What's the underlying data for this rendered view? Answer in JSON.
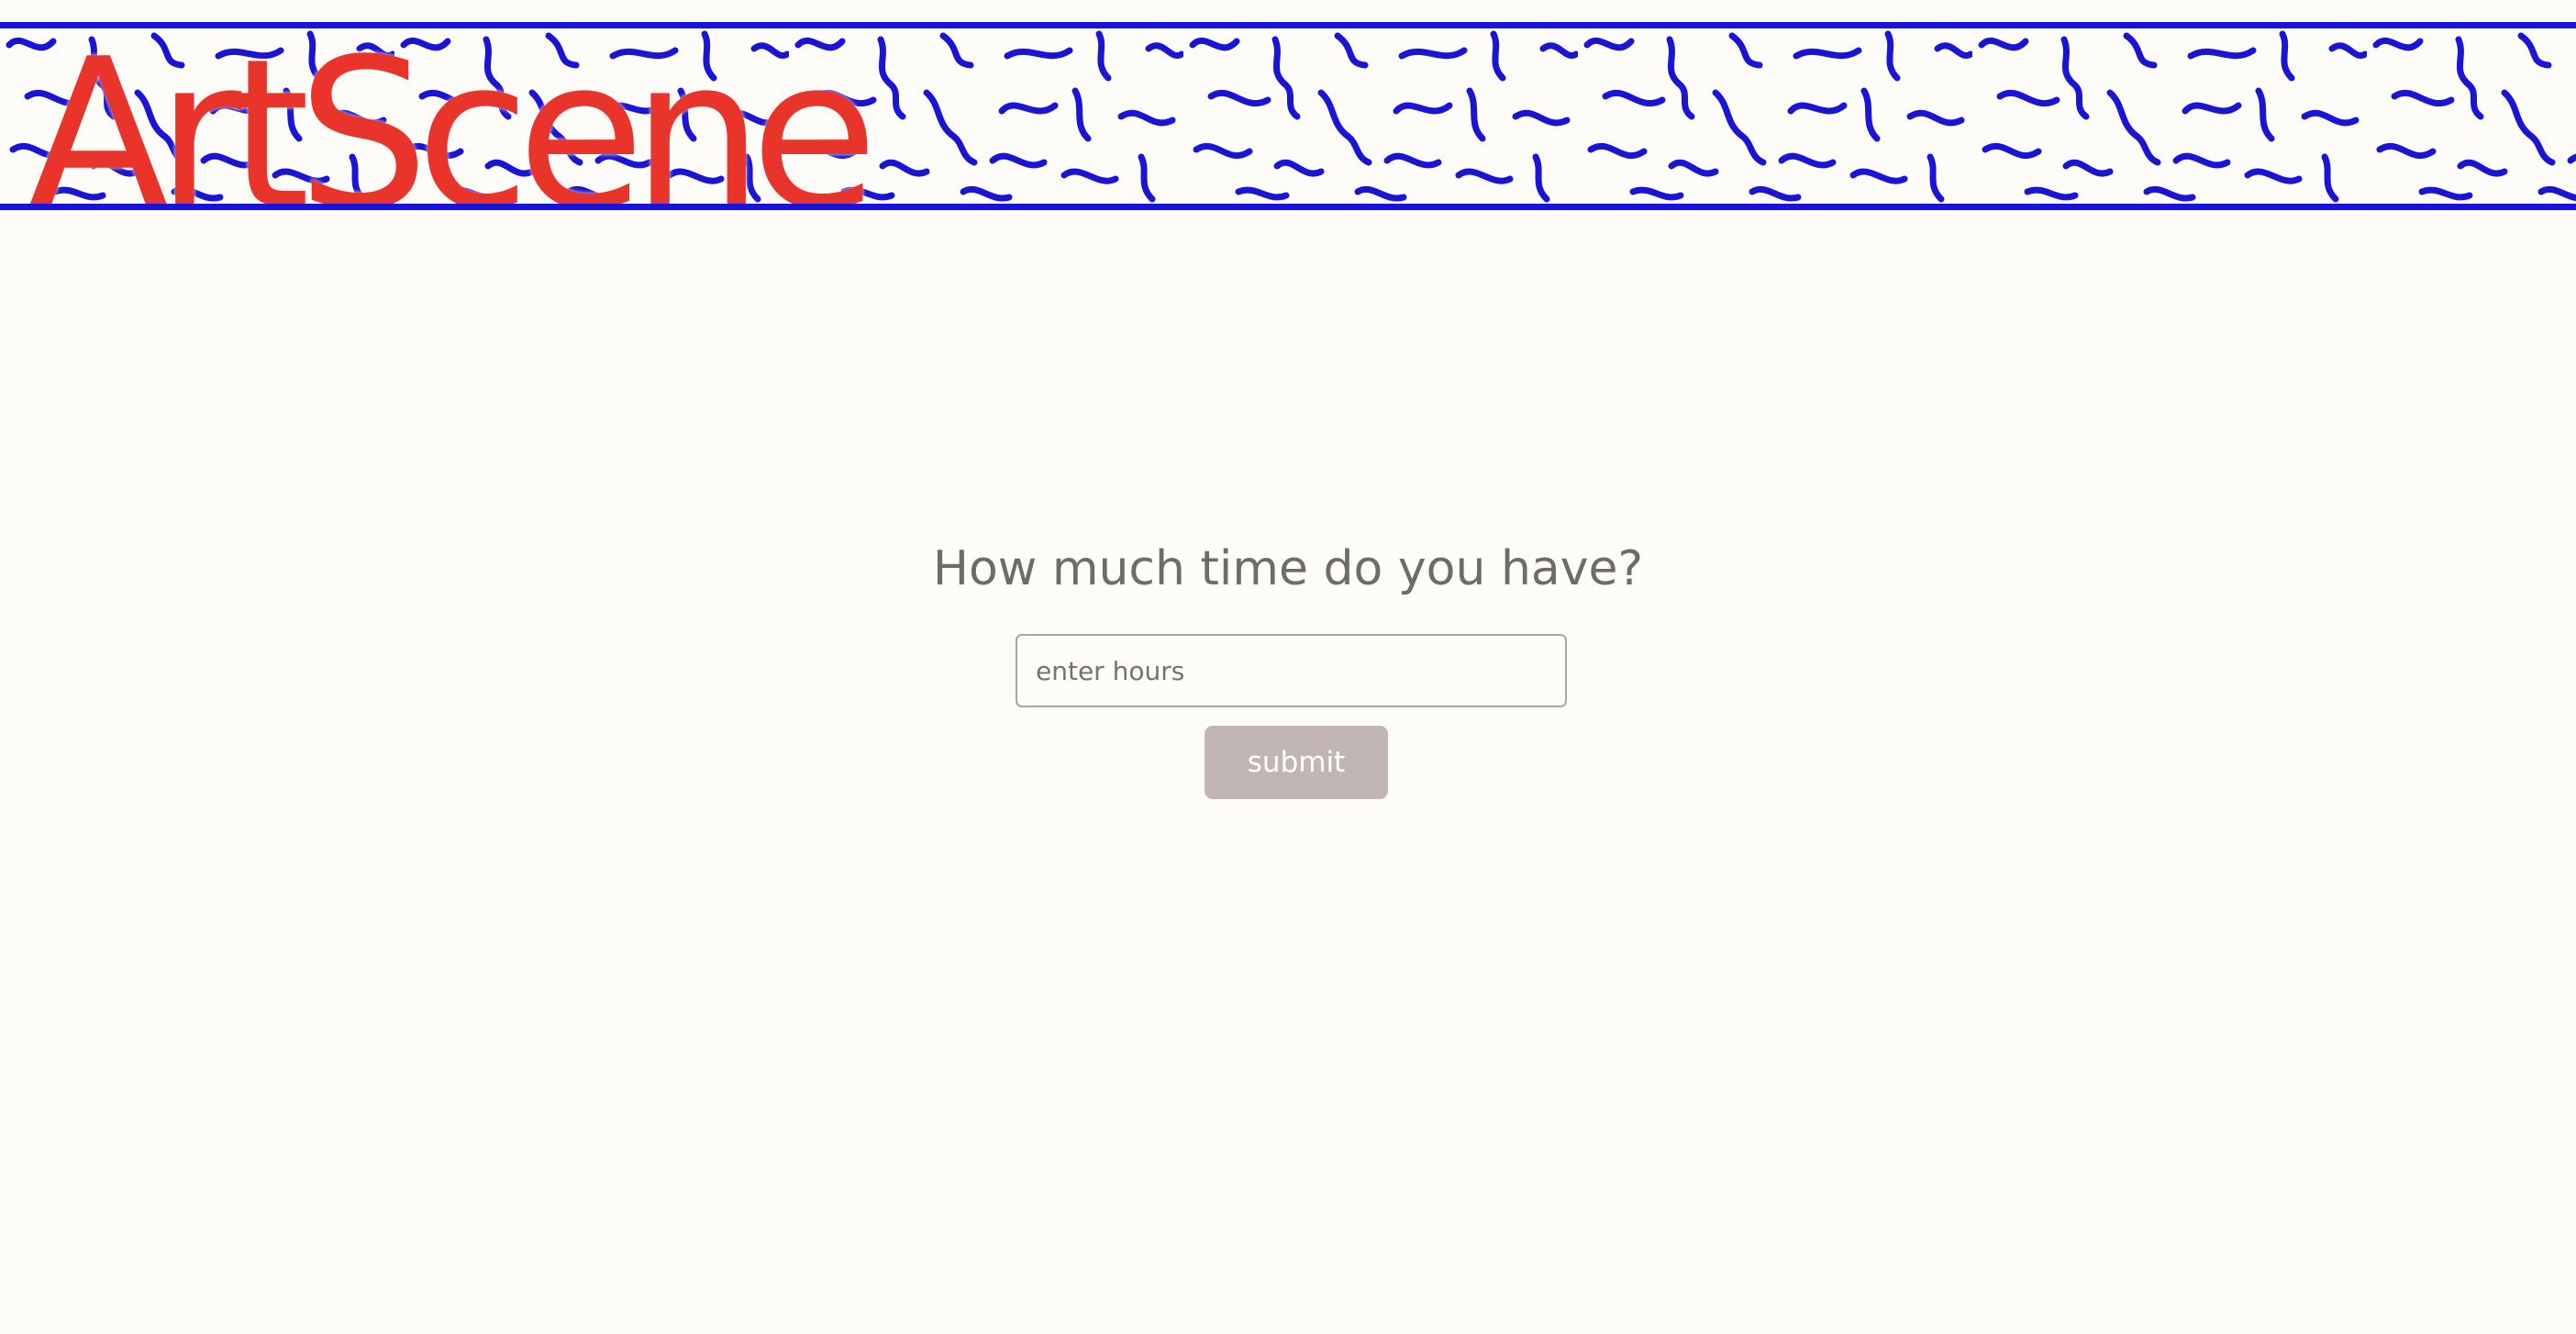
{
  "header": {
    "logo_text": "ArtScene",
    "logo_color": "#e8342a",
    "pattern_color": "#1a14d6"
  },
  "main": {
    "question": "How much time do you have?",
    "hours_input": {
      "value": "",
      "placeholder": "enter hours"
    },
    "submit_label": "submit"
  },
  "colors": {
    "background": "#fdfcf8",
    "text": "#6f6b68",
    "button": "#c2b6b5"
  }
}
